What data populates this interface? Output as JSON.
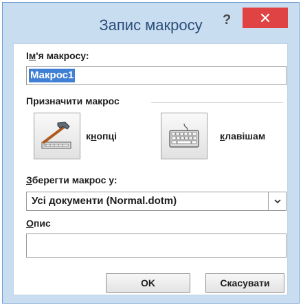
{
  "dialog": {
    "title": "Запис макросу",
    "help": "?",
    "close_icon": "close-icon"
  },
  "macro_name": {
    "label_accel": "м",
    "label_pre": "І",
    "label_post": "'я макросу:",
    "value": "Макрос1"
  },
  "assign": {
    "label": "Призначити макрос",
    "button": {
      "label_pre": "к",
      "label_accel": "н",
      "label_post": "опці",
      "icon": "hammer-icon"
    },
    "keyboard": {
      "label_accel": "к",
      "label_post": "лавішам",
      "icon": "keyboard-icon"
    }
  },
  "store_in": {
    "label_accel": "З",
    "label_post": "берегти макрос у:",
    "selected": "Усі документи (Normal.dotm)"
  },
  "description": {
    "label_accel": "О",
    "label_post": "пис",
    "value": ""
  },
  "buttons": {
    "ok": "OK",
    "cancel": "Скасувати"
  },
  "colors": {
    "frame": "#c9ddf0",
    "close": "#e04343",
    "selection": "#3f7fd4"
  }
}
